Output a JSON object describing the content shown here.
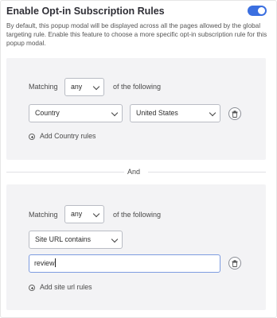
{
  "header": {
    "title": "Enable Opt-in Subscription Rules",
    "toggle_on": true,
    "accent_color": "#3b6fe0",
    "description": "By default, this popup modal will be displayed across all the pages allowed by the global targeting rule. Enable this feature to choose a more specific opt-in subscription rule for this popup modal."
  },
  "group1": {
    "matching_label": "Matching",
    "matching_value": "any",
    "of_following_label": "of the following",
    "field_value": "Country",
    "condition_value": "United States",
    "add_rule_label": "Add Country rules"
  },
  "separator": {
    "label": "And"
  },
  "group2": {
    "matching_label": "Matching",
    "matching_value": "any",
    "of_following_label": "of the following",
    "field_value": "Site URL contains",
    "input_value": "review",
    "add_rule_label": "Add site url rules"
  }
}
